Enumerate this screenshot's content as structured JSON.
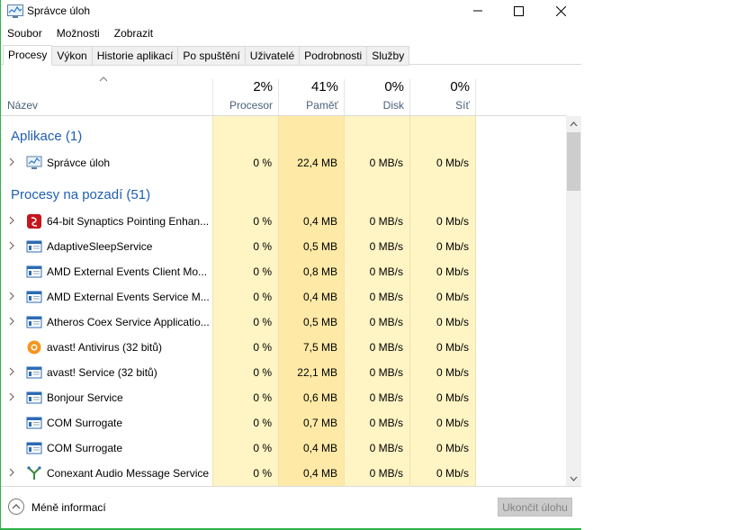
{
  "window": {
    "title": "Správce úloh",
    "icon": "task-manager-icon"
  },
  "menu": [
    "Soubor",
    "Možnosti",
    "Zobrazit"
  ],
  "tabs": [
    "Procesy",
    "Výkon",
    "Historie aplikací",
    "Po spuštění",
    "Uživatelé",
    "Podrobnosti",
    "Služby"
  ],
  "active_tab": "Procesy",
  "columns": {
    "name": "Název",
    "cpu": {
      "pct": "2%",
      "label": "Procesor"
    },
    "mem": {
      "pct": "41%",
      "label": "Paměť"
    },
    "disk": {
      "pct": "0%",
      "label": "Disk"
    },
    "net": {
      "pct": "0%",
      "label": "Síť"
    }
  },
  "groups": {
    "apps": "Aplikace (1)",
    "background": "Procesy na pozadí (51)"
  },
  "apps": [
    {
      "name": "Správce úloh",
      "cpu": "0 %",
      "mem": "22,4 MB",
      "disk": "0 MB/s",
      "net": "0 Mb/s",
      "expand": true,
      "icon": "task-manager-icon"
    }
  ],
  "processes": [
    {
      "name": "64-bit Synaptics Pointing Enhan...",
      "cpu": "0 %",
      "mem": "0,4 MB",
      "disk": "0 MB/s",
      "net": "0 Mb/s",
      "expand": true,
      "icon": "synaptics-icon"
    },
    {
      "name": "AdaptiveSleepService",
      "cpu": "0 %",
      "mem": "0,5 MB",
      "disk": "0 MB/s",
      "net": "0 Mb/s",
      "expand": true,
      "icon": "service-window-icon"
    },
    {
      "name": "AMD External Events Client Mo...",
      "cpu": "0 %",
      "mem": "0,8 MB",
      "disk": "0 MB/s",
      "net": "0 Mb/s",
      "expand": false,
      "icon": "service-window-icon"
    },
    {
      "name": "AMD External Events Service M...",
      "cpu": "0 %",
      "mem": "0,4 MB",
      "disk": "0 MB/s",
      "net": "0 Mb/s",
      "expand": true,
      "icon": "service-window-icon"
    },
    {
      "name": "Atheros Coex Service Applicatio...",
      "cpu": "0 %",
      "mem": "0,5 MB",
      "disk": "0 MB/s",
      "net": "0 Mb/s",
      "expand": true,
      "icon": "service-window-icon"
    },
    {
      "name": "avast! Antivirus (32 bitů)",
      "cpu": "0 %",
      "mem": "7,5 MB",
      "disk": "0 MB/s",
      "net": "0 Mb/s",
      "expand": false,
      "icon": "avast-icon"
    },
    {
      "name": "avast! Service (32 bitů)",
      "cpu": "0 %",
      "mem": "22,1 MB",
      "disk": "0 MB/s",
      "net": "0 Mb/s",
      "expand": true,
      "icon": "service-window-icon"
    },
    {
      "name": "Bonjour Service",
      "cpu": "0 %",
      "mem": "0,6 MB",
      "disk": "0 MB/s",
      "net": "0 Mb/s",
      "expand": true,
      "icon": "service-window-icon"
    },
    {
      "name": "COM Surrogate",
      "cpu": "0 %",
      "mem": "0,7 MB",
      "disk": "0 MB/s",
      "net": "0 Mb/s",
      "expand": false,
      "icon": "service-window-icon"
    },
    {
      "name": "COM Surrogate",
      "cpu": "0 %",
      "mem": "0,4 MB",
      "disk": "0 MB/s",
      "net": "0 Mb/s",
      "expand": false,
      "icon": "service-window-icon"
    },
    {
      "name": "Conexant Audio Message Service",
      "cpu": "0 %",
      "mem": "0,4 MB",
      "disk": "0 MB/s",
      "net": "0 Mb/s",
      "expand": true,
      "icon": "conexant-icon"
    }
  ],
  "footer": {
    "fewer_details": "Méně informací",
    "end_task": "Ukončit úlohu"
  },
  "colors": {
    "accent_blue": "#1e5fb4",
    "cpu_fill": "#fff4c4",
    "mem_fill": "#ffe9a6",
    "io_fill": "#fff4c4",
    "border_green": "#2fb34a"
  }
}
